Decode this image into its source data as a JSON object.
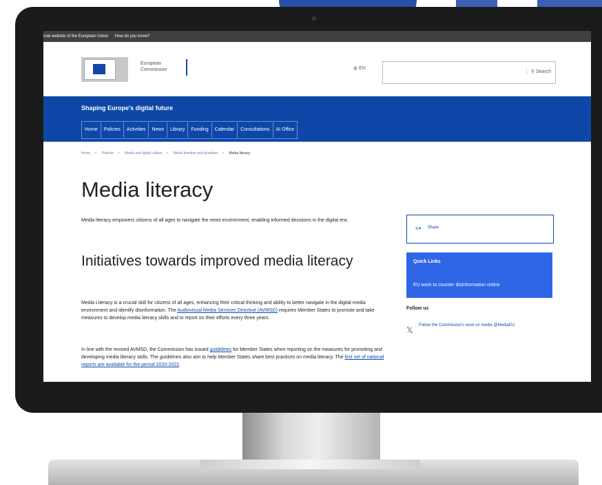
{
  "topbar": {
    "official": "icial website of the European Union",
    "how": "How do you know?"
  },
  "logo": {
    "line1": "European",
    "line2": "Commission"
  },
  "header": {
    "lang": "EN",
    "search_label": "Search"
  },
  "site": {
    "name": "Shaping Europe's digital future"
  },
  "nav": {
    "items": [
      "Home",
      "Policies",
      "Activities",
      "News",
      "Library",
      "Funding",
      "Calendar",
      "Consultations",
      "AI Office"
    ]
  },
  "breadcrumb": [
    "Home",
    "Policies",
    "Media and digital culture",
    "Media freedom and pluralism",
    "Media literacy"
  ],
  "page": {
    "title": "Media literacy",
    "intro": "Media literacy empowers citizens of all ages to navigate the news environment, enabling informed decisions in the digital era.",
    "section_heading": "Initiatives towards improved media literacy",
    "p1": {
      "before": "Media Literacy is a crucial skill for citizens of all ages, enhancing their critical thinking and ability to better navigate in the digital media environment and identify disinformation. The ",
      "link": "Audiovisual Media Services Directive (AVMSD)",
      "after": " requires Member States to promote and take measures to develop media literacy skills and to report on their efforts every three years."
    },
    "p2": {
      "before": "In line with the revised AVMSD, the Commission has issued ",
      "link1": "guidelines",
      "middle": " for Member States when reporting on the measures for promoting and developing media literacy skills. The guidelines also aim to help Member States share best practices on media literacy. The ",
      "link2": "first set of national reports are available for the period 2020-2022",
      "after": "."
    }
  },
  "sidebar": {
    "share_label": "Share",
    "quick_links_title": "Quick Links",
    "quick_link": "EU work to counter disinformation online",
    "follow_title": "Follow us",
    "follow_link": "Follow the Commission's work on media @MediaEU"
  },
  "icons": {
    "share": "share-icon",
    "x": "x-logo-icon",
    "search": "search-icon",
    "globe": "globe-icon"
  },
  "colors": {
    "brand_blue": "#0e47a8",
    "quick_links_blue": "#2f66e8",
    "topbar": "#404040"
  }
}
